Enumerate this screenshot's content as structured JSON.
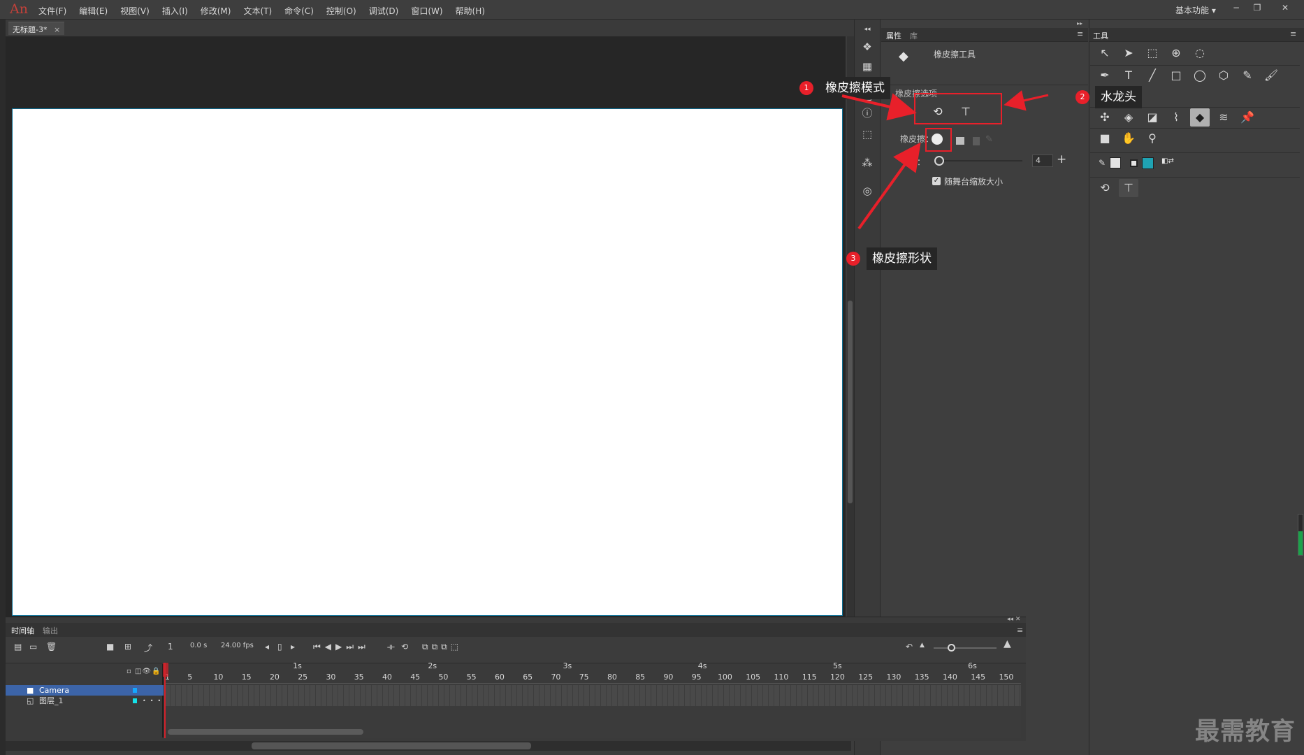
{
  "app": {
    "logo": "An",
    "menu": [
      "文件(F)",
      "编辑(E)",
      "视图(V)",
      "插入(I)",
      "修改(M)",
      "文本(T)",
      "命令(C)",
      "控制(O)",
      "调试(D)",
      "窗口(W)",
      "帮助(H)"
    ],
    "workspace": "基本功能",
    "window_buttons": [
      "−",
      "❐",
      "✕"
    ]
  },
  "document": {
    "tab_label": "无标题-3*",
    "tab_close": "×"
  },
  "properties": {
    "tabs": [
      "属性",
      "库"
    ],
    "tool_title": "橡皮擦工具",
    "options_label": "橡皮擦选项",
    "shape_label": "橡皮擦：",
    "size_label": "小：",
    "size_value": "4",
    "size_plus": "+",
    "scale_checkbox": "随舞台缩放大小",
    "scale_checked": true
  },
  "tools_panel": {
    "title": "工具"
  },
  "callouts": [
    {
      "number": "1",
      "text": "橡皮擦模式"
    },
    {
      "number": "2",
      "text": "水龙头"
    },
    {
      "number": "3",
      "text": "橡皮擦形状"
    }
  ],
  "timeline": {
    "tabs": [
      "时间轴",
      "输出"
    ],
    "current_frame": "1",
    "time": "0.0 s",
    "fps": "24.00 fps",
    "seconds": [
      "1s",
      "2s",
      "3s",
      "4s",
      "5s",
      "6s"
    ],
    "frame_numbers": [
      "1",
      "5",
      "10",
      "15",
      "20",
      "25",
      "30",
      "35",
      "40",
      "45",
      "50",
      "55",
      "60",
      "65",
      "70",
      "75",
      "80",
      "85",
      "90",
      "95",
      "100",
      "105",
      "110",
      "115",
      "120",
      "125",
      "130",
      "135",
      "140",
      "145",
      "150"
    ],
    "layers": [
      {
        "name": "Camera",
        "selected": true
      },
      {
        "name": "图层_1",
        "selected": false
      }
    ]
  },
  "watermark": "最需教育",
  "colors": {
    "accent_red": "#e8202a",
    "fill_color": "#1fa3b3",
    "selected_layer": "#3c64a8",
    "stage": "#ffffff"
  }
}
